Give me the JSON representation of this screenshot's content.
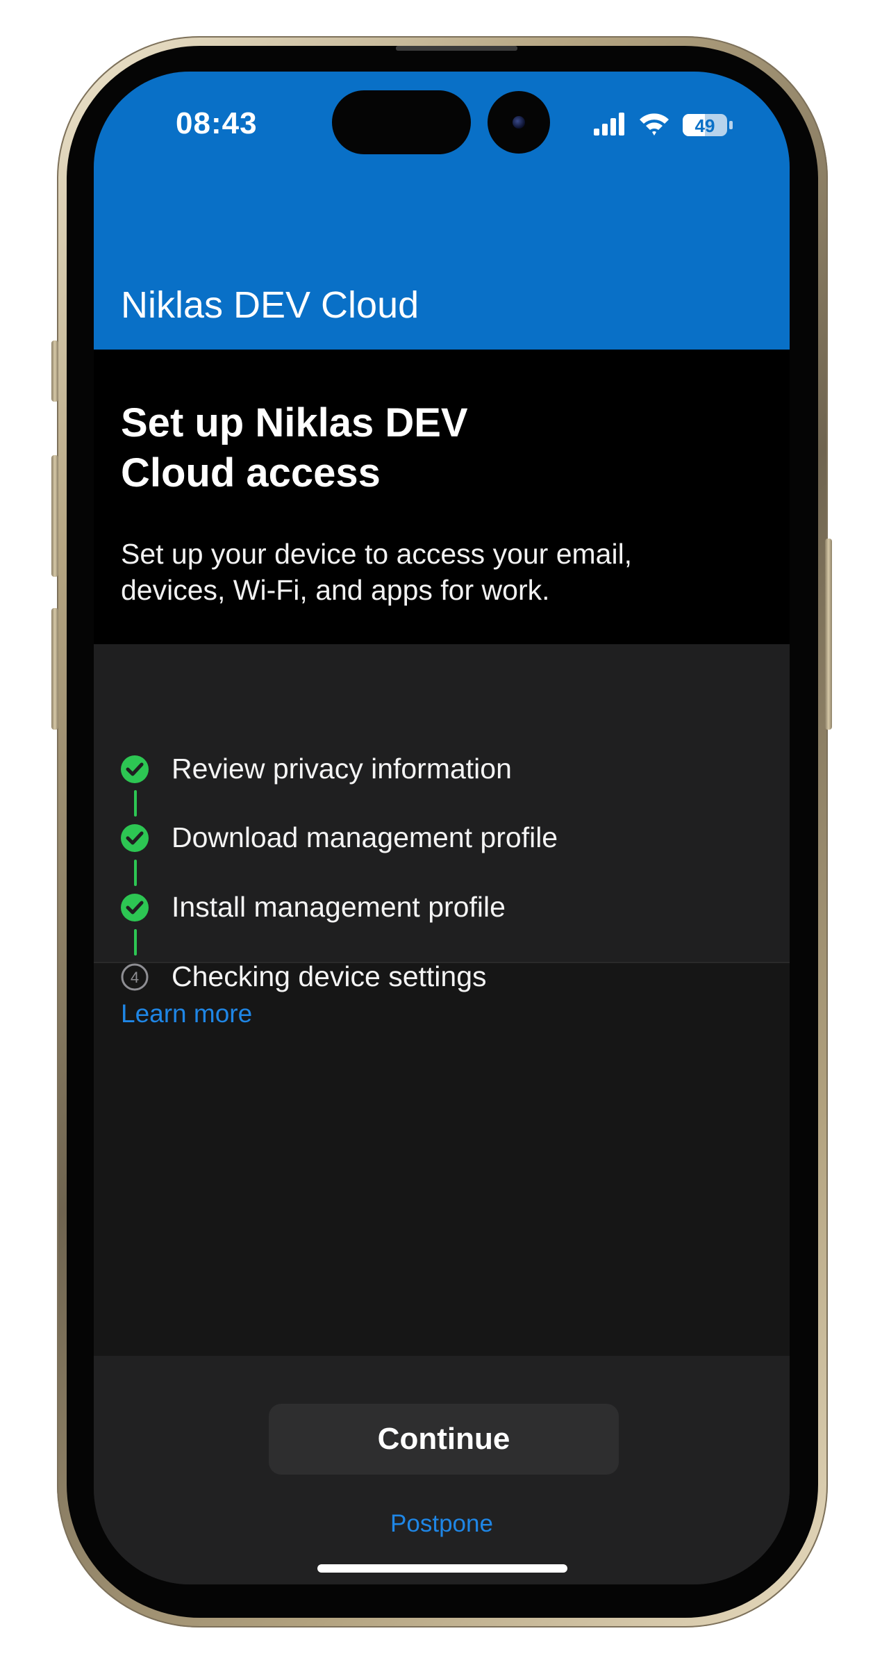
{
  "status_bar": {
    "time": "08:43",
    "battery": "49",
    "icons": [
      "signal-icon",
      "wifi-icon",
      "battery-icon"
    ]
  },
  "header": {
    "title": "Niklas DEV Cloud",
    "color": "#0970c7"
  },
  "intro": {
    "heading_line1": "Set up Niklas DEV",
    "heading_line2": "Cloud access",
    "description_line1": "Set up your device to access your email,",
    "description_line2": "devices, Wi-Fi, and apps for work."
  },
  "steps": [
    {
      "label": "Review privacy information",
      "status": "complete",
      "icon": "check-circle-icon"
    },
    {
      "label": "Download management profile",
      "status": "complete",
      "icon": "check-circle-icon"
    },
    {
      "label": "Install management profile",
      "status": "complete",
      "icon": "check-circle-icon"
    },
    {
      "label": "Checking device settings",
      "status": "pending",
      "number": "4",
      "icon": "number-circle-icon"
    }
  ],
  "learn_more": "Learn more",
  "footer": {
    "continue_label": "Continue",
    "postpone_label": "Postpone"
  },
  "colors": {
    "accent": "#1f86e5",
    "success": "#2dc653"
  }
}
